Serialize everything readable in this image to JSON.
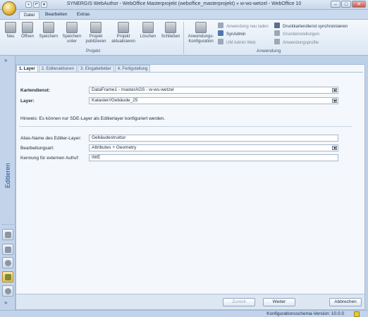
{
  "window": {
    "title": "SYNERGIS WebAuthor - WebOffice Masterprojekt (weboffice_masterprojekt) » w-ws-wetzel - WebOffice 10"
  },
  "ribbon_tabs": [
    "Datei",
    "Bearbeiten",
    "Extras"
  ],
  "ribbon": {
    "project_group": {
      "label": "Projekt",
      "buttons": [
        "Neu",
        "Öffnen",
        "Speichern",
        "Speichern unter",
        "Projekt publizieren",
        "Projekt aktualisieren",
        "Löschen",
        "Schließen"
      ]
    },
    "app_group": {
      "label": "Anwendung",
      "config_button": "Anwendungs-Konfiguration",
      "items": [
        "Anwendung neu laden",
        "SynAdmin",
        "UM Admin Web",
        "Druckkartendienst synchronisieren",
        "Grundeinstellungen",
        "Anwendungsprofile"
      ]
    }
  },
  "sidebar": {
    "vertical_label": "Editieren",
    "chevron_top": "»",
    "chevron_bottom": "»"
  },
  "wizard": {
    "tabs": [
      "1. Layer",
      "2. Editieraktionen",
      "3. Eingabefelder",
      "4. Fertigstellung"
    ],
    "kartendienst_label": "Kartendienst:",
    "kartendienst_value": "DataFrame1 - masterAGS - w-ws-wetzel",
    "layer_label": "Layer:",
    "layer_value": "Kataster//Gebäude_25",
    "hint": "Hinweis: Es können nur SDE-Layer als Editierlayer konfiguriert werden.",
    "alias_label": "Alias-Name des Editier-Layer:",
    "alias_value": "Gebäudestruktur",
    "edit_type_label": "Bearbeitungsart:",
    "edit_type_value": "Attributes + Geometry",
    "external_label": "Kennung für externen Aufruf:",
    "external_value": "IWE"
  },
  "buttons": {
    "back": "Zurück",
    "next": "Weiter",
    "cancel": "Abbrechen"
  },
  "status": {
    "version": "Konfigurationsschema-Version: 10.0.0"
  }
}
